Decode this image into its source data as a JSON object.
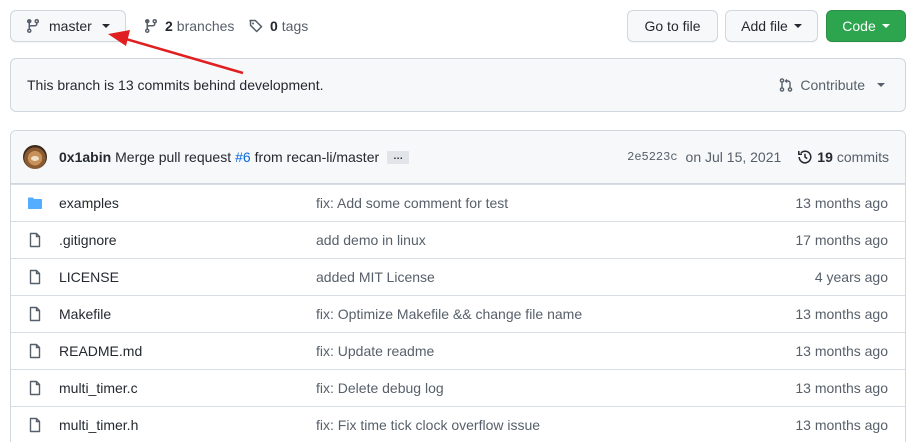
{
  "repo_nav": {
    "branch_name": "master",
    "branches_count": "2",
    "branches_label": "branches",
    "tags_count": "0",
    "tags_label": "tags",
    "goto_file_label": "Go to file",
    "add_file_label": "Add file",
    "code_label": "Code"
  },
  "banner": {
    "text": "This branch is 13 commits behind development.",
    "contribute_label": "Contribute"
  },
  "latest_commit": {
    "author": "0x1abin",
    "message_prefix": "Merge pull request",
    "pr_ref": "#6",
    "message_suffix": "from recan-li/master",
    "ellipsis": "…",
    "sha": "2e5223c",
    "date": "on Jul 15, 2021",
    "commits_count": "19",
    "commits_label": "commits"
  },
  "files": [
    {
      "type": "folder",
      "name": "examples",
      "message": "fix: Add some comment for test",
      "age": "13 months ago"
    },
    {
      "type": "file",
      "name": ".gitignore",
      "message": "add demo in linux",
      "age": "17 months ago"
    },
    {
      "type": "file",
      "name": "LICENSE",
      "message": "added MIT License",
      "age": "4 years ago"
    },
    {
      "type": "file",
      "name": "Makefile",
      "message": "fix: Optimize Makefile && change file name",
      "age": "13 months ago"
    },
    {
      "type": "file",
      "name": "README.md",
      "message": "fix: Update readme",
      "age": "13 months ago"
    },
    {
      "type": "file",
      "name": "multi_timer.c",
      "message": "fix: Delete debug log",
      "age": "13 months ago"
    },
    {
      "type": "file",
      "name": "multi_timer.h",
      "message": "fix: Fix time tick clock overflow issue",
      "age": "13 months ago"
    }
  ],
  "colors": {
    "accent_link": "#0969da",
    "code_button": "#2da44e",
    "folder_icon": "#54aeff",
    "annotation_arrow": "#e02020"
  }
}
